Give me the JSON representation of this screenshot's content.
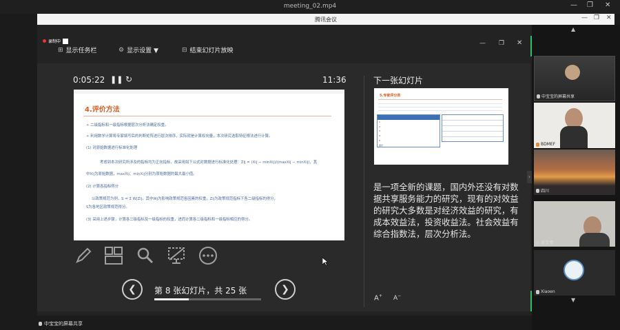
{
  "window": {
    "title": "meeting_02.mp4"
  },
  "meeting": {
    "title": "腾讯会议"
  },
  "presenter": {
    "recording_label": "录制中",
    "toolbar": {
      "taskbar": "显示任务栏",
      "display_settings": "显示设置 ▼",
      "end_show": "结束幻灯片放映"
    },
    "elapsed": "0:05:22",
    "clock": "11:36",
    "next_slide_label": "下一张幻灯片",
    "slide_counter": "第 8 张幻灯片，共 25 张",
    "progress": 0.32,
    "notes": "是一项全新的课题，国内外还没有对数据共享服务能力的研究，现有的对效益的研究大多数是对经济效益的研究，有成本效益法，投资收益法。社会效益有综合指数法，层次分析法。",
    "current_slide": {
      "title": "4.评价方法",
      "lines": [
        "➢ 二级指标和一级指标根据层次分析法确定权重。",
        "➢ 利用数学计算将专家填写后的判断矩阵进行层次排序，实际就是计算权向量，本次研究选取特征根法进行计算。",
        "(1) 对原始数据进行标准化处理",
        "考虑到本次研究所涉及的指标均为正向指标，故采用如下公式对数据进行标准化处理：Zij = (Xij − minXij)/(maxXij − minXij)，其",
        "中Xij为原始数据，maxXij、minXij分别为原始数据的最大最小值。",
        "(2) 计算各指标得分",
        "以政策规范为例，S = Σ WjZij，其中Wj为影响政策规范各因素的权重，Zij为政策规范指标下各二级指标的得分，",
        "S为各地区政策规范得分。",
        "(3) 采用上述步骤，计算各二级指标及一级指标的权重，进而计算各二级指标和一级指标相应的得分。"
      ]
    },
    "next_slide": {
      "title": "5.专家评分表",
      "rows": [
        "1",
        "2",
        "3",
        "4",
        "5",
        "合计"
      ]
    }
  },
  "sharer": {
    "label": "中宝宝的屏幕共享"
  },
  "participants": [
    {
      "name": "中宝宝的屏幕共享"
    },
    {
      "name": "BDMEF"
    },
    {
      "name": "四川"
    },
    {
      "name": "谢宝博"
    },
    {
      "name": "Xiaoen"
    }
  ],
  "colors": {
    "accent_green": "#27c26a",
    "slide_title": "#e05a20",
    "slide_text": "#4c6aa0"
  }
}
